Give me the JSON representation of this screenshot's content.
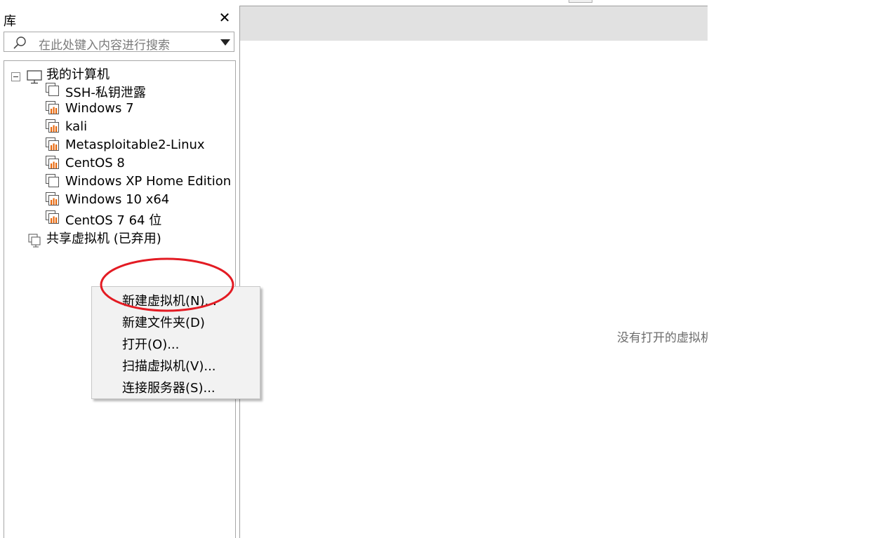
{
  "library": {
    "title": "库",
    "close_symbol": "✕",
    "search": {
      "placeholder": "在此处键入内容进行搜索",
      "icon": "search-icon"
    },
    "tree": {
      "root": {
        "label": "我的计算机",
        "icon": "computer-icon",
        "expander": "minus"
      },
      "vms": [
        {
          "label": "SSH-私钥泄露",
          "icon": "vm-icon"
        },
        {
          "label": "Windows 7",
          "icon": "vm-running-icon"
        },
        {
          "label": "kali",
          "icon": "vm-running-icon"
        },
        {
          "label": "Metasploitable2-Linux",
          "icon": "vm-running-icon"
        },
        {
          "label": "CentOS 8",
          "icon": "vm-running-icon"
        },
        {
          "label": "Windows XP Home Edition",
          "icon": "vm-icon"
        },
        {
          "label": "Windows 10 x64",
          "icon": "vm-running-icon"
        },
        {
          "label": "CentOS 7 64 位",
          "icon": "vm-running-icon"
        }
      ],
      "shared": {
        "label": "共享虚拟机 (已弃用)",
        "icon": "shared-vms-icon"
      }
    }
  },
  "main": {
    "empty_text": "没有打开的虚拟机"
  },
  "context_menu": {
    "items": [
      {
        "label": "新建虚拟机(N)..."
      },
      {
        "label": "新建文件夹(D)"
      },
      {
        "label": "打开(O)..."
      },
      {
        "label": "扫描虚拟机(V)..."
      },
      {
        "label": "连接服务器(S)..."
      }
    ]
  },
  "colors": {
    "annotation": "#e31b23",
    "vm_bars": "#e86a10",
    "toolbar_bg": "#e1e1e1",
    "menu_bg": "#f2f2f2"
  }
}
